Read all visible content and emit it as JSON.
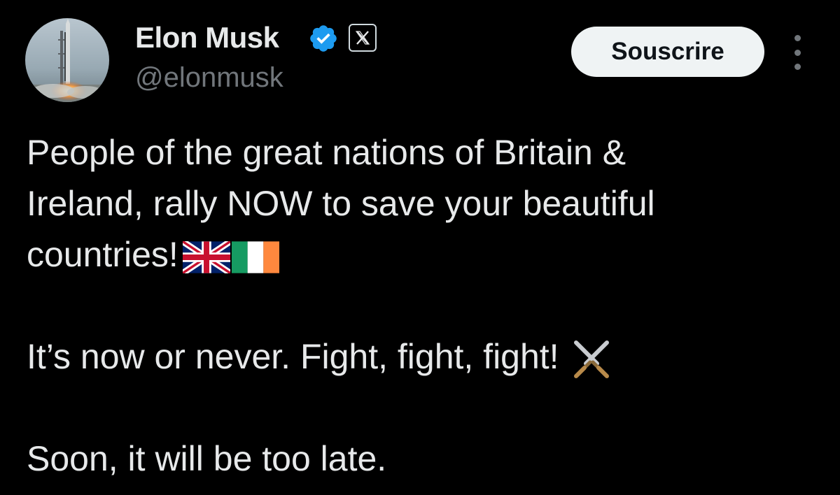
{
  "author": {
    "name": "Elon Musk",
    "handle": "@elonmusk",
    "avatar_icon": "rocket-launch-avatar",
    "verified_icon": "verified-badge-icon",
    "verified_color": "#1d9bf0",
    "affiliate_icon": "x-logo-icon"
  },
  "actions": {
    "subscribe_label": "Souscrire",
    "more_icon": "more-vertical-icon"
  },
  "tweet": {
    "lines": [
      "People of the great nations of Britain &",
      "Ireland, rally NOW to save your beautiful",
      "countries!",
      "",
      "It’s now or never. Fight, fight, fight!",
      "",
      "Soon, it will be too late."
    ],
    "emojis": {
      "uk_flag": "🇬🇧",
      "ireland_flag": "🇮🇪",
      "crossed_swords": "⚔️"
    }
  },
  "colors": {
    "background": "#000000",
    "primary_text": "#e7e9ea",
    "secondary_text": "#71767b",
    "button_bg": "#eff3f4",
    "button_text": "#0f1419"
  }
}
